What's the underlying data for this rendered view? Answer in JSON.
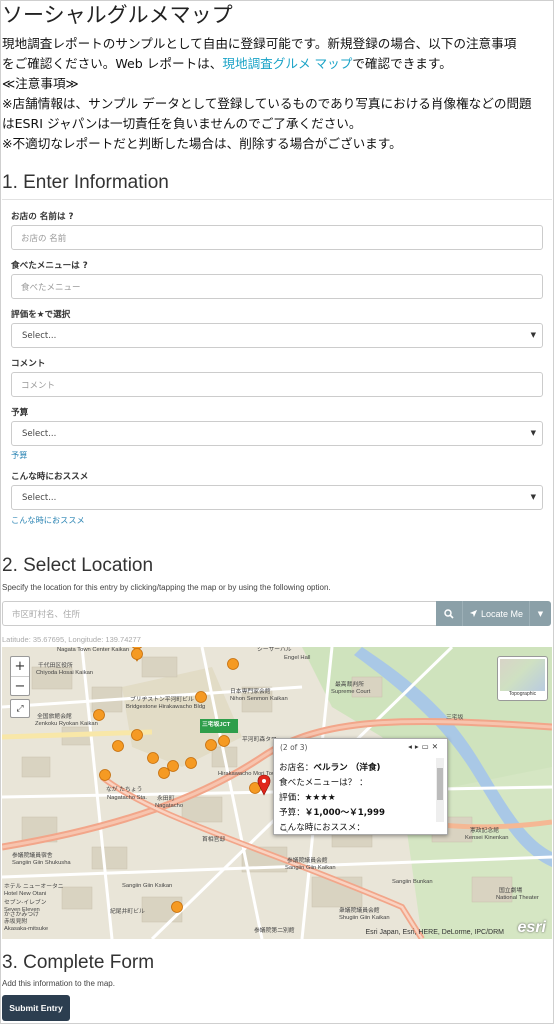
{
  "page": {
    "title": "ソーシャルグルメマップ",
    "intro_line1": "現地調査レポートのサンプルとして自由に登録可能です。新規登録の場合、以下の注意事項",
    "intro_line2_a": "をご確認ください。Web レポートは、",
    "intro_line2_link": "現地調査グルメ マップ",
    "intro_line2_b": "で確認できます。",
    "notice_heading": "≪注意事項≫",
    "notice_line1": "※店舗情報は、サンプル データとして登録しているものであり写真における肖像権などの問題",
    "notice_line2": "はESRI ジャパンは一切責任を負いませんのでご了承ください。",
    "notice_line3": "※不適切なレポートだと判断した場合は、削除する場合がございます。"
  },
  "section1": {
    "heading": "1. Enter Information",
    "fields": {
      "shop_name": {
        "label": "お店の 名前は ?",
        "placeholder": "お店の 名前"
      },
      "menu": {
        "label": "食べたメニューは ?",
        "placeholder": "食べたメニュー"
      },
      "rating": {
        "label": "評価を★で選択",
        "value": "Select..."
      },
      "comment": {
        "label": "コメント",
        "placeholder": "コメント"
      },
      "budget": {
        "label": "予算",
        "value": "Select...",
        "help": "予算"
      },
      "recommend": {
        "label": "こんな時におススメ",
        "value": "Select...",
        "help": "こんな時におススメ"
      }
    }
  },
  "section2": {
    "heading": "2. Select Location",
    "description": "Specify the location for this entry by clicking/tapping the map or by using the following option.",
    "address_placeholder": "市区町村名、住所",
    "locate_label": "Locate Me",
    "latlon": "Latitude: 35.67695, Longitude: 139.74277",
    "map": {
      "zoom_in": "+",
      "zoom_out": "−",
      "basemap_label": "Topographic",
      "attribution": "Esri Japan, Esri, HERE, DeLorme, IPC/DRM",
      "logo": "esri",
      "station_sign": "三宅坂JCT",
      "labels": [
        "Nagata Town Center Kaikan",
        "千代田区役所",
        "Chiyoda Hosai Kaikan",
        "シーサーハル",
        "Engel Hall",
        "日本専門家会館",
        "Nihon Senmon Kaikan",
        "最高裁判所",
        "Supreme Court",
        "三宅坂",
        "ブリヂストン平河町ビル",
        "Bridgestone Hirakawacho Bldg",
        "全国旅館会館",
        "Zenkoku Ryokan Kaikan",
        "平河町森タワー",
        "Hirakawacho Mori Tower",
        "なが たちょう",
        "Nagatacho Sta.",
        "永田町",
        "Nagatacho",
        "参議院議員会館",
        "Sangiin Giin Kaikan",
        "参議院議員宿舎",
        "Sangiin Giin Shukusha",
        "首相官邸",
        "Sangiin Bunkan",
        "Sangiin Giin Ksikan",
        "憲政記念館",
        "Kensei Kinenkan",
        "国立劇場",
        "National Theater",
        "ホテル ニューオータニ",
        "Hotel New Otani",
        "衆議院議員会館",
        "Shugiin Giin Kaikan",
        "紀尾井町ビル",
        "セブン-イレブン",
        "Seven Eleven",
        "赤坂見附",
        "Akasaka-mitsuke",
        "かさかみつけ",
        "参議院第二別館"
      ],
      "popup": {
        "pager": "(2 of 3)",
        "shop_label": "お店名：",
        "shop_value": "ベルラン （洋食)",
        "menu_line": "食べたメニューは？ ：",
        "rating_label": "評価：",
        "rating_value": "★★★★",
        "budget_label": "予算：",
        "budget_value": "￥1,000～￥1,999",
        "recommend_label": "こんな時におススメ："
      }
    }
  },
  "section3": {
    "heading": "3. Complete Form",
    "description": "Add this information to the map.",
    "submit_label": "Submit Entry"
  },
  "colors": {
    "accent": "#1aa3c7",
    "button_gray": "#8ba0a8",
    "submit": "#2c3e50",
    "marker": "#f59a23",
    "water": "#a9c8e6"
  }
}
